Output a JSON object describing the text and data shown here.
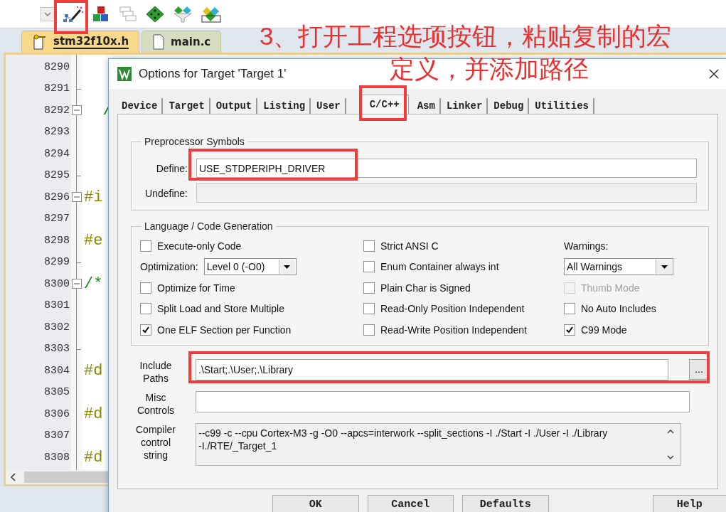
{
  "editor": {
    "tabs": [
      {
        "label": "stm32f10x.h",
        "selected": true
      },
      {
        "label": "main.c",
        "selected": false
      }
    ],
    "lines": [
      {
        "number": "8290"
      },
      {
        "number": "8291",
        "kind": "fold_end"
      },
      {
        "number": "8292",
        "kind": "fold_start",
        "code": "  /",
        "color": "#1a8a1a"
      },
      {
        "number": "8293"
      },
      {
        "number": "8294"
      },
      {
        "number": "8295",
        "kind": "fold_end"
      },
      {
        "number": "8296",
        "kind": "fold_start",
        "code": "#i",
        "color": "#8a8a00"
      },
      {
        "number": "8297"
      },
      {
        "number": "8298",
        "code": "#e",
        "color": "#8a8a00"
      },
      {
        "number": "8299",
        "kind": "fold_end"
      },
      {
        "number": "8300",
        "kind": "fold_start",
        "code": "/*",
        "color": "#1a8a1a"
      },
      {
        "number": "8301"
      },
      {
        "number": "8302"
      },
      {
        "number": "8303",
        "kind": "fold_end"
      },
      {
        "number": "8304",
        "code": "#d",
        "color": "#8a8a00"
      },
      {
        "number": "8305"
      },
      {
        "number": "8306",
        "code": "#d",
        "color": "#8a8a00"
      },
      {
        "number": "8307"
      },
      {
        "number": "8308",
        "code": "#d",
        "color": "#8a8a00"
      }
    ]
  },
  "dialog": {
    "title": "Options for Target 'Target 1'",
    "tabs": [
      {
        "label": "Device",
        "selected": false
      },
      {
        "label": "Target",
        "selected": false
      },
      {
        "label": "Output",
        "selected": false
      },
      {
        "label": "Listing",
        "selected": false
      },
      {
        "label": "User",
        "selected": false
      },
      {
        "label": "C/C++",
        "selected": true
      },
      {
        "label": "Asm",
        "selected": false
      },
      {
        "label": "Linker",
        "selected": false
      },
      {
        "label": "Debug",
        "selected": false
      },
      {
        "label": "Utilities",
        "selected": false
      }
    ],
    "preprocessor": {
      "title": "Preprocessor Symbols",
      "fields": [
        {
          "label": "Define:",
          "value": "USE_STDPERIPH_DRIVER",
          "disabled": false
        },
        {
          "label": "Undefine:",
          "disabled": true
        }
      ]
    },
    "codegen": {
      "title": "Language / Code Generation",
      "columns": [
        [
          {
            "kind": "checkbox",
            "label": "Execute-only Code",
            "checked": false,
            "disabled": false
          },
          {
            "kind": "select",
            "label": "Optimization:",
            "value": "Level 0 (-O0)"
          },
          {
            "kind": "checkbox",
            "label": "Optimize for Time",
            "checked": false,
            "disabled": false
          },
          {
            "kind": "checkbox",
            "label": "Split Load and Store Multiple",
            "checked": false,
            "disabled": false
          },
          {
            "kind": "checkbox",
            "label": "One ELF Section per Function",
            "checked": true,
            "disabled": false
          }
        ],
        [
          {
            "kind": "checkbox",
            "label": "Strict ANSI C",
            "checked": false,
            "disabled": false
          },
          {
            "kind": "checkbox",
            "label": "Enum Container always int",
            "checked": false,
            "disabled": false
          },
          {
            "kind": "checkbox",
            "label": "Plain Char is Signed",
            "checked": false,
            "disabled": false
          },
          {
            "kind": "checkbox",
            "label": "Read-Only Position Independent",
            "checked": false,
            "disabled": false
          },
          {
            "kind": "checkbox",
            "label": "Read-Write Position Independent",
            "checked": false,
            "disabled": false
          }
        ],
        [
          {
            "kind": "label",
            "label": "Warnings:"
          },
          {
            "kind": "select",
            "value": "All Warnings"
          },
          {
            "kind": "checkbox",
            "label": "Thumb Mode",
            "checked": false,
            "disabled": true
          },
          {
            "kind": "checkbox",
            "label": "No Auto Includes",
            "checked": false,
            "disabled": false
          },
          {
            "kind": "checkbox",
            "label": "C99 Mode",
            "checked": true,
            "disabled": false
          }
        ]
      ]
    },
    "paths": [
      {
        "kind": "browse",
        "label": "Include Paths",
        "value": ".\\Start;.\\User;.\\Library",
        "button": "..."
      },
      {
        "kind": "text",
        "label": "Misc Controls"
      },
      {
        "kind": "multiline",
        "label": "Compiler control string",
        "lines": [
          "--c99 -c --cpu Cortex-M3 -g -O0 --apcs=interwork --split_sections -I ./Start -I ./User -I ./Library",
          "-I./RTE/_Target_1"
        ]
      }
    ],
    "buttons": [
      "OK",
      "Cancel",
      "Defaults",
      "Help"
    ]
  },
  "annotation": {
    "lines": [
      "3、打开工程选项按钮，粘贴复制的宏",
      "定义，并添加路径"
    ]
  }
}
